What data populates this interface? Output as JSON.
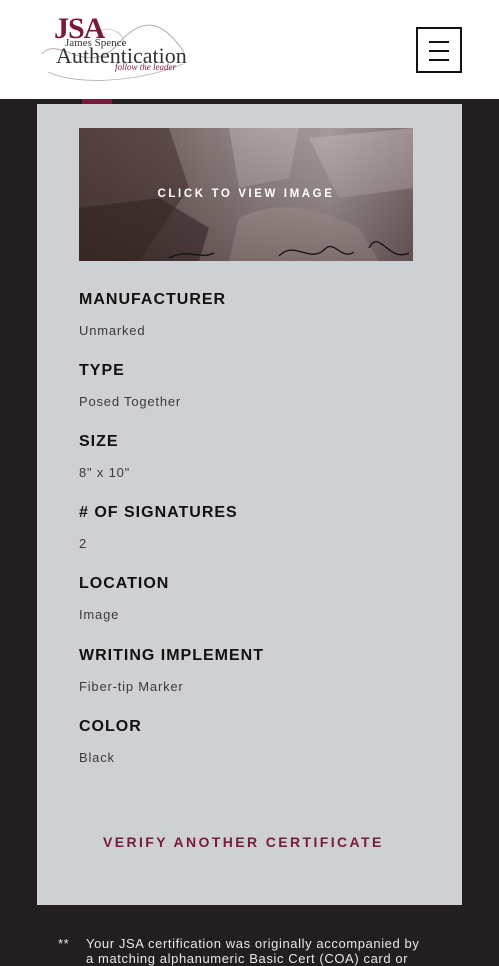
{
  "header": {
    "logo": {
      "jsa": "JSA",
      "name": "James Spence",
      "authentication": "Authentication",
      "tagline": "follow the leader"
    },
    "menu_icon": "hamburger-menu-icon"
  },
  "card": {
    "image_label": "CLICK TO VIEW IMAGE",
    "fields": [
      {
        "label": "MANUFACTURER",
        "value": "Unmarked"
      },
      {
        "label": "TYPE",
        "value": "Posed Together"
      },
      {
        "label": "SIZE",
        "value": "8\" x 10\""
      },
      {
        "label": "# OF SIGNATURES",
        "value": "2"
      },
      {
        "label": "LOCATION",
        "value": "Image"
      },
      {
        "label": "WRITING IMPLEMENT",
        "value": "Fiber-tip Marker"
      },
      {
        "label": "COLOR",
        "value": "Black"
      }
    ],
    "verify_label": "VERIFY ANOTHER CERTIFICATE"
  },
  "footnote": {
    "stars": "**",
    "line1": "Your JSA certification was originally accompanied by",
    "line2": "a matching alphanumeric Basic Cert (COA) card or"
  },
  "colors": {
    "brand": "#7a1a3a",
    "page_bg": "#231f20",
    "card_bg": "#cfd0d3"
  }
}
